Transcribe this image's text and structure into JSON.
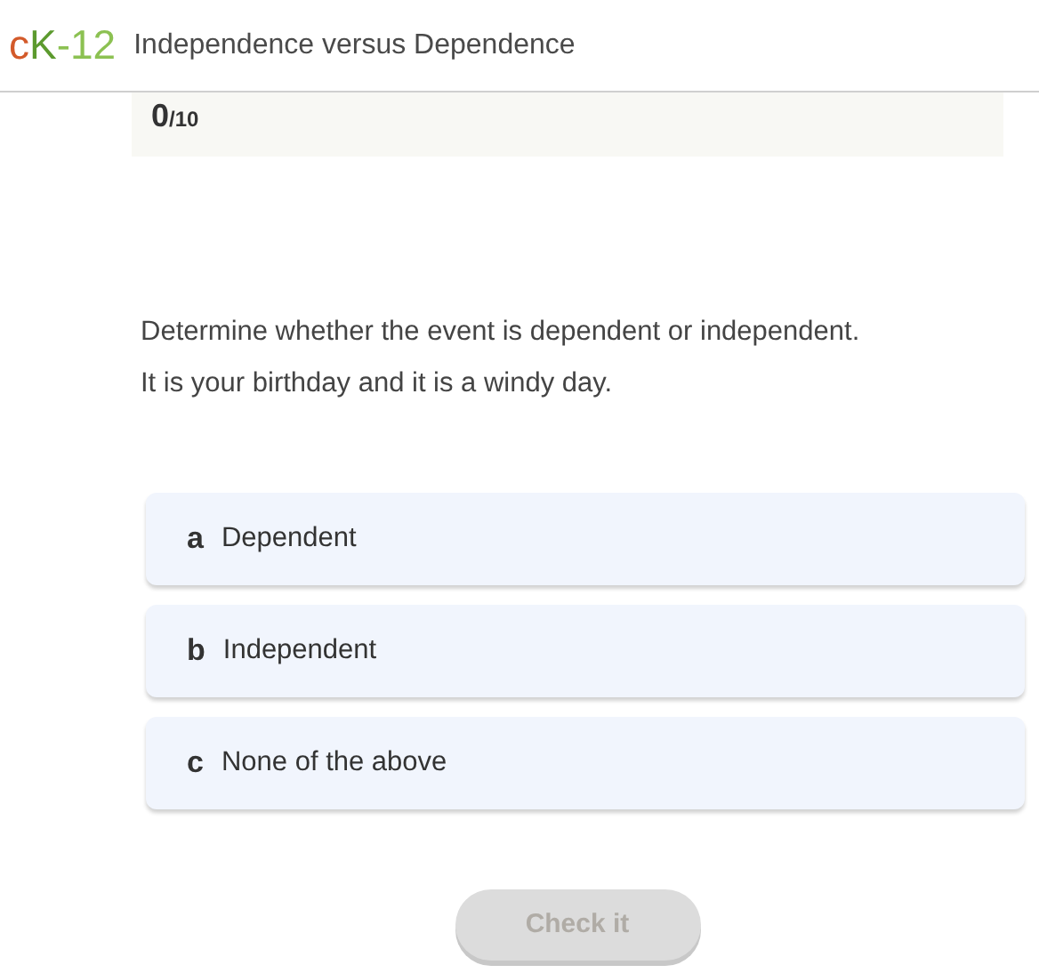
{
  "header": {
    "logo": [
      {
        "text": "c",
        "color": "#d35a2a"
      },
      {
        "text": "K",
        "color": "#5c9a2e"
      },
      {
        "text": "-12",
        "color": "#8cc152"
      }
    ],
    "title": "Independence versus Dependence"
  },
  "score": {
    "value": "0",
    "total": "/10"
  },
  "question": {
    "lines": [
      "Determine whether the event is dependent or independent.",
      "It is your birthday and it is a windy day."
    ]
  },
  "options": [
    {
      "letter": "a",
      "label": "Dependent",
      "selected": false
    },
    {
      "letter": "b",
      "label": "Independent",
      "selected": false
    },
    {
      "letter": "c",
      "label": "None of the above",
      "selected": false
    }
  ],
  "check_button": {
    "label": "Check it",
    "disabled": true
  }
}
